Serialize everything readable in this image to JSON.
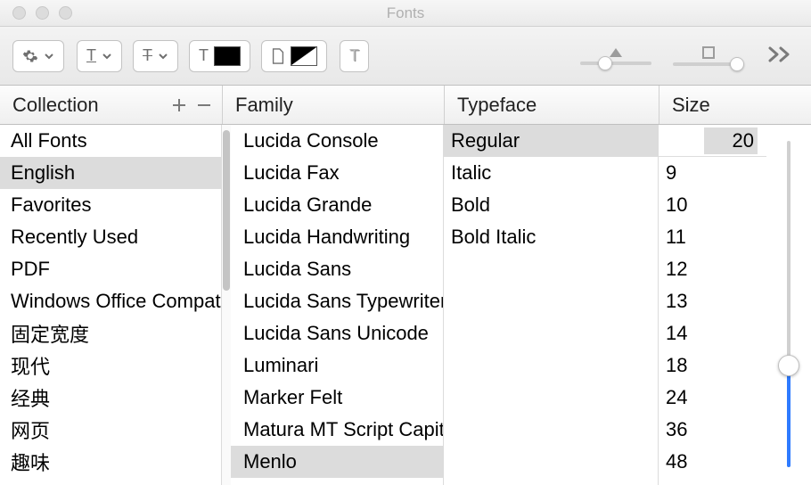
{
  "window": {
    "title": "Fonts"
  },
  "headers": {
    "collection": "Collection",
    "family": "Family",
    "typeface": "Typeface",
    "size": "Size"
  },
  "collections": [
    {
      "label": "All Fonts",
      "selected": false
    },
    {
      "label": "English",
      "selected": true
    },
    {
      "label": "Favorites",
      "selected": false
    },
    {
      "label": "Recently Used",
      "selected": false
    },
    {
      "label": "PDF",
      "selected": false
    },
    {
      "label": "Windows Office Compatible",
      "selected": false
    },
    {
      "label": "固定宽度",
      "selected": false
    },
    {
      "label": "现代",
      "selected": false
    },
    {
      "label": "经典",
      "selected": false
    },
    {
      "label": "网页",
      "selected": false
    },
    {
      "label": "趣味",
      "selected": false
    }
  ],
  "families": [
    {
      "label": "Lucida Console",
      "selected": false
    },
    {
      "label": "Lucida Fax",
      "selected": false
    },
    {
      "label": "Lucida Grande",
      "selected": false
    },
    {
      "label": "Lucida Handwriting",
      "selected": false
    },
    {
      "label": "Lucida Sans",
      "selected": false
    },
    {
      "label": "Lucida Sans Typewriter",
      "selected": false
    },
    {
      "label": "Lucida Sans Unicode",
      "selected": false
    },
    {
      "label": "Luminari",
      "selected": false
    },
    {
      "label": "Marker Felt",
      "selected": false
    },
    {
      "label": "Matura MT Script Capitals",
      "selected": false
    },
    {
      "label": "Menlo",
      "selected": true
    }
  ],
  "typefaces": [
    {
      "label": "Regular",
      "selected": true
    },
    {
      "label": "Italic",
      "selected": false
    },
    {
      "label": "Bold",
      "selected": false
    },
    {
      "label": "Bold Italic",
      "selected": false
    }
  ],
  "size": {
    "current": "20",
    "options": [
      "9",
      "10",
      "11",
      "12",
      "13",
      "14",
      "18",
      "24",
      "36",
      "48"
    ]
  }
}
